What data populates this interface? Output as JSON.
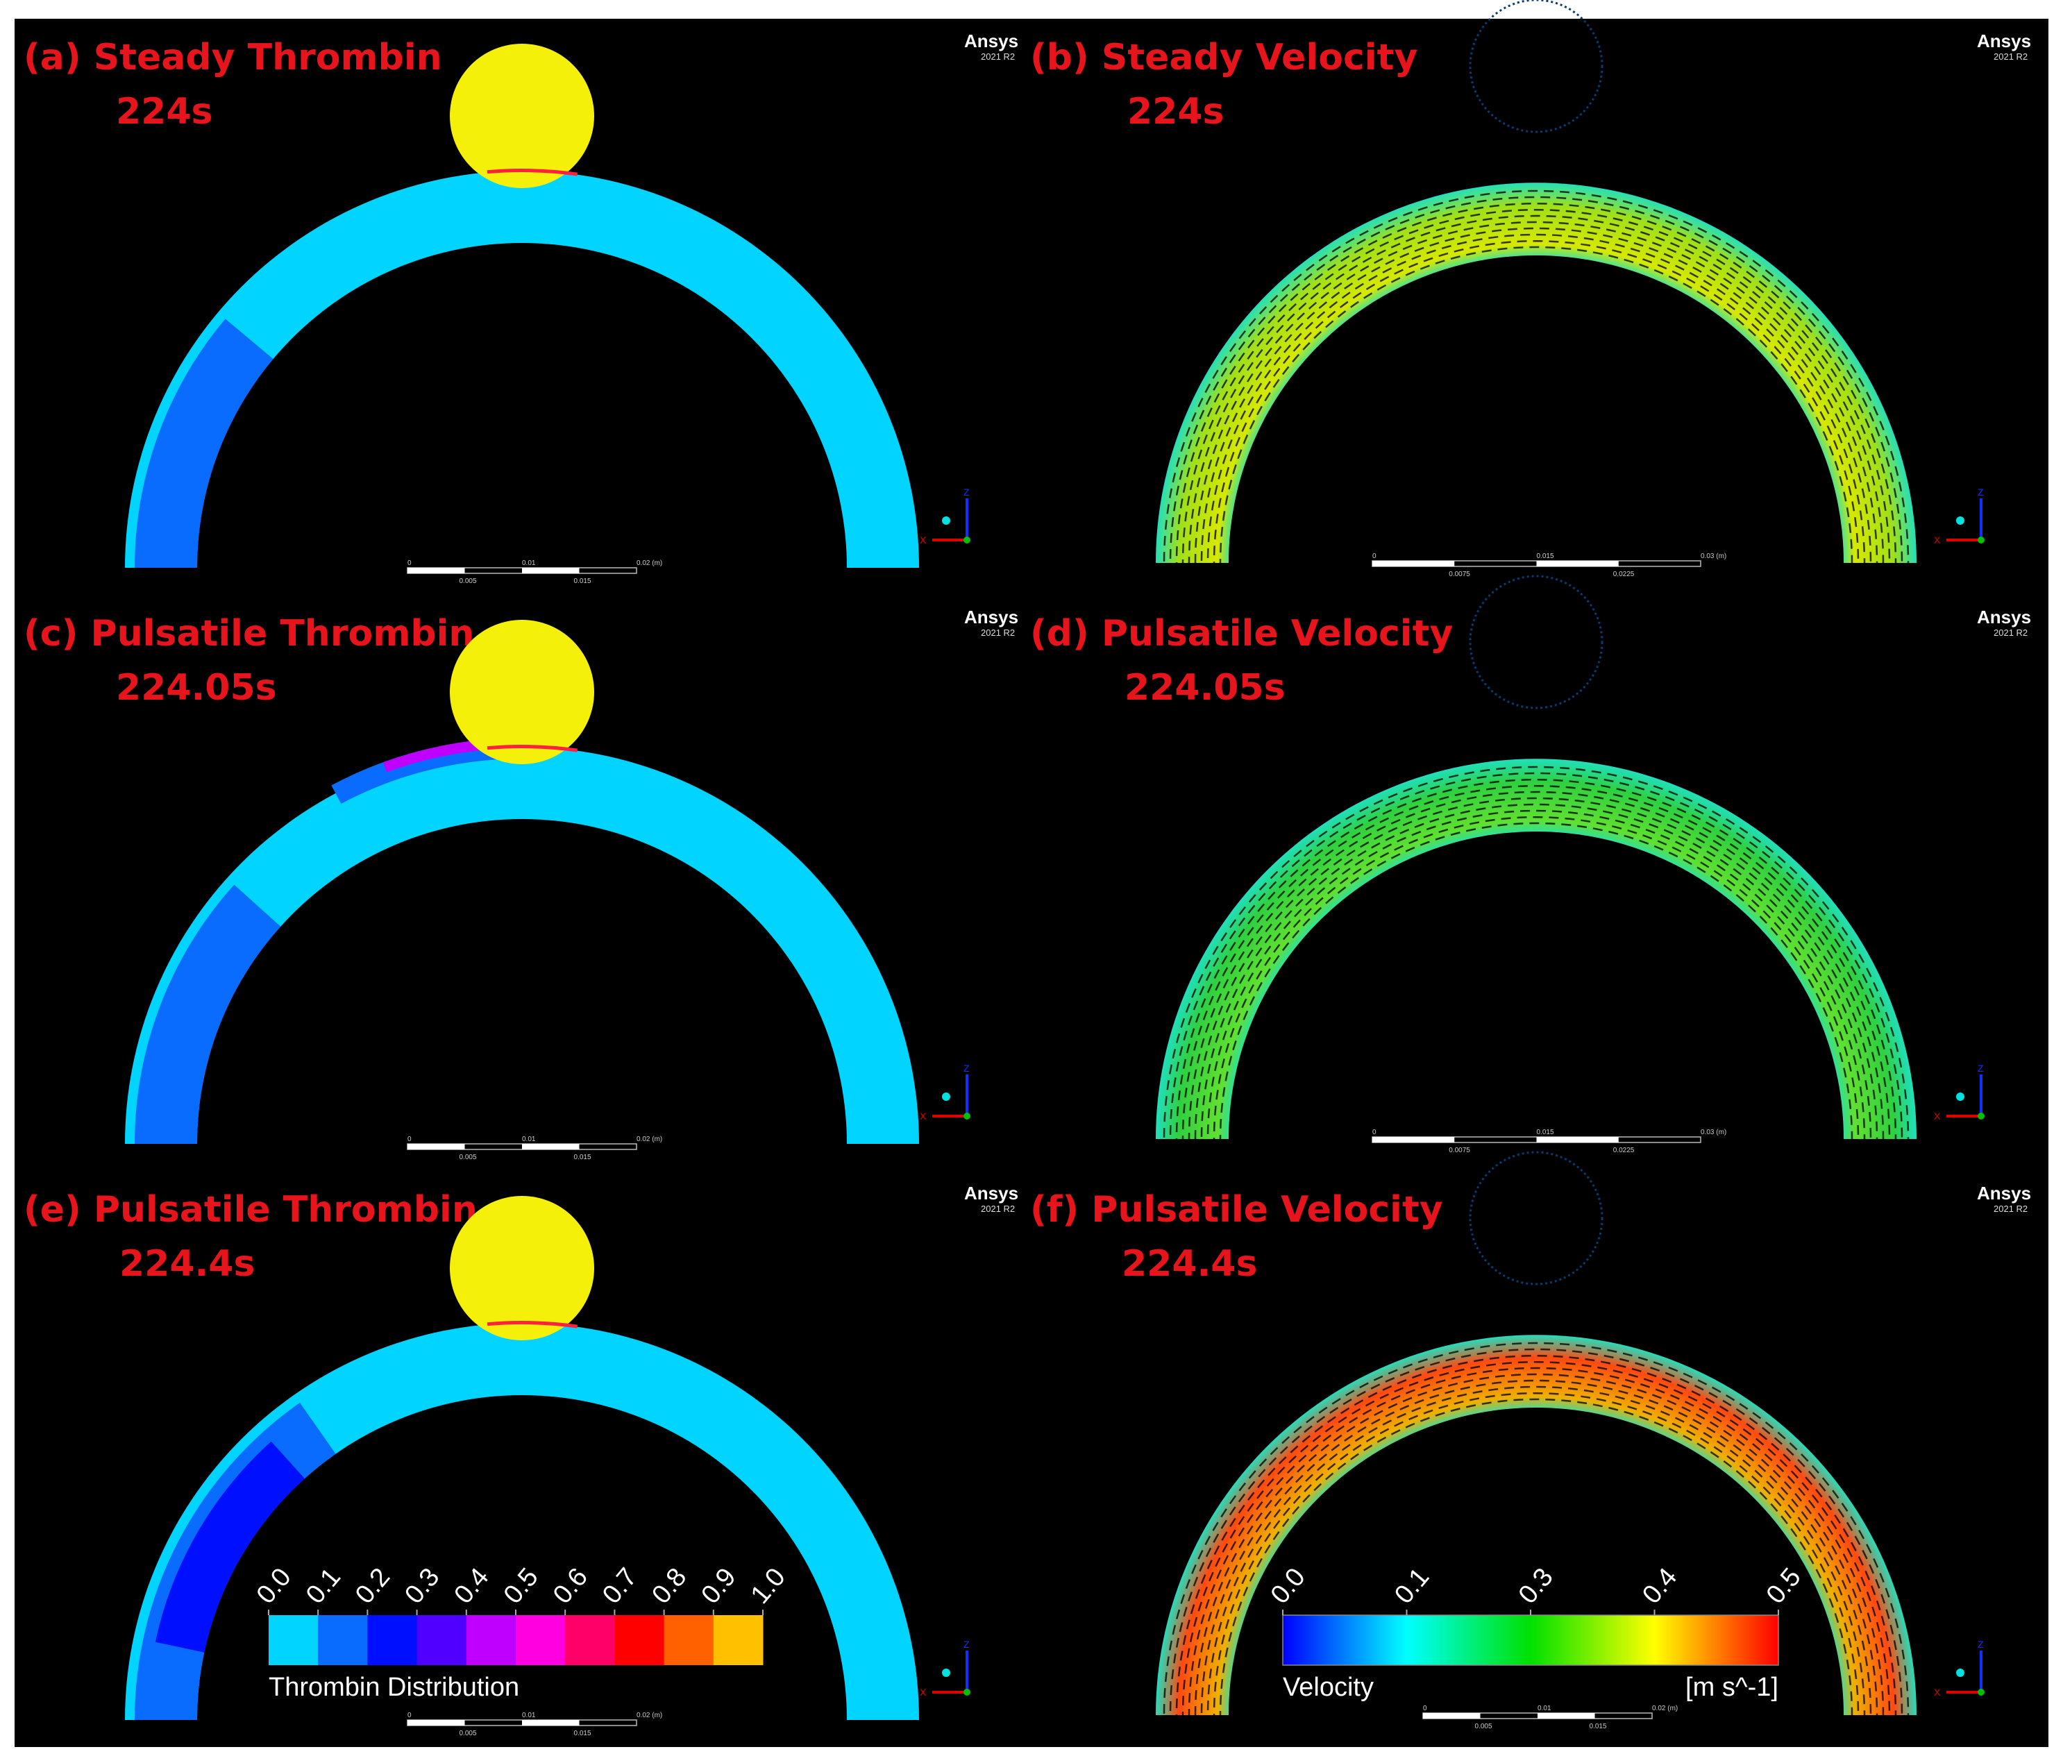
{
  "brand": {
    "name": "Ansys",
    "version": "2021 R2"
  },
  "panels": [
    {
      "id": "a",
      "kind": "thrombin",
      "title": "(a) Steady Thrombin",
      "time": "224s"
    },
    {
      "id": "b",
      "kind": "velocity",
      "title": "(b) Steady Velocity",
      "time": "224s"
    },
    {
      "id": "c",
      "kind": "thrombin",
      "title": "(c) Pulsatile Thrombin",
      "time": "224.05s"
    },
    {
      "id": "d",
      "kind": "velocity",
      "title": "(d) Pulsatile Velocity",
      "time": "224.05s"
    },
    {
      "id": "e",
      "kind": "thrombin",
      "title": "(e) Pulsatile Thrombin",
      "time": "224.4s"
    },
    {
      "id": "f",
      "kind": "velocity",
      "title": "(f) Pulsatile Velocity",
      "time": "224.4s"
    }
  ],
  "scale_bars": {
    "thrombin": {
      "top": [
        "0",
        "0.01",
        "0.02 (m)"
      ],
      "bottom": [
        "0.005",
        "0.015"
      ]
    },
    "velocity": {
      "top": [
        "0",
        "0.015",
        "0.03 (m)"
      ],
      "bottom": [
        "0.0075",
        "0.0225"
      ]
    },
    "velocity_f": {
      "top": [
        "0",
        "0.01",
        "0.02 (m)"
      ],
      "bottom": [
        "0.005",
        "0.015"
      ]
    }
  },
  "axis_labels": {
    "x": "X",
    "z": "Z"
  },
  "legends": {
    "thrombin": {
      "title": "Thrombin Distribution",
      "ticks": [
        "0.0",
        "0.1",
        "0.2",
        "0.3",
        "0.4",
        "0.5",
        "0.6",
        "0.7",
        "0.8",
        "0.9",
        "1.0"
      ],
      "colors": [
        "#00d4ff",
        "#0a6cff",
        "#0010ff",
        "#5000ff",
        "#c000ff",
        "#ff00e0",
        "#ff0068",
        "#ff0000",
        "#ff6000",
        "#ffc000"
      ]
    },
    "velocity": {
      "title": "Velocity",
      "unit": "[m s^-1]",
      "ticks": [
        "0.0",
        "0.1",
        "0.3",
        "0.4",
        "0.5"
      ],
      "colors": [
        "#0000ff",
        "#00ffff",
        "#00e000",
        "#ffff00",
        "#ff0000"
      ]
    }
  },
  "colors": {
    "sphere": "#f5f00a",
    "vessel": "#00d4ff",
    "background": "#000000",
    "title": "#e8141c"
  }
}
